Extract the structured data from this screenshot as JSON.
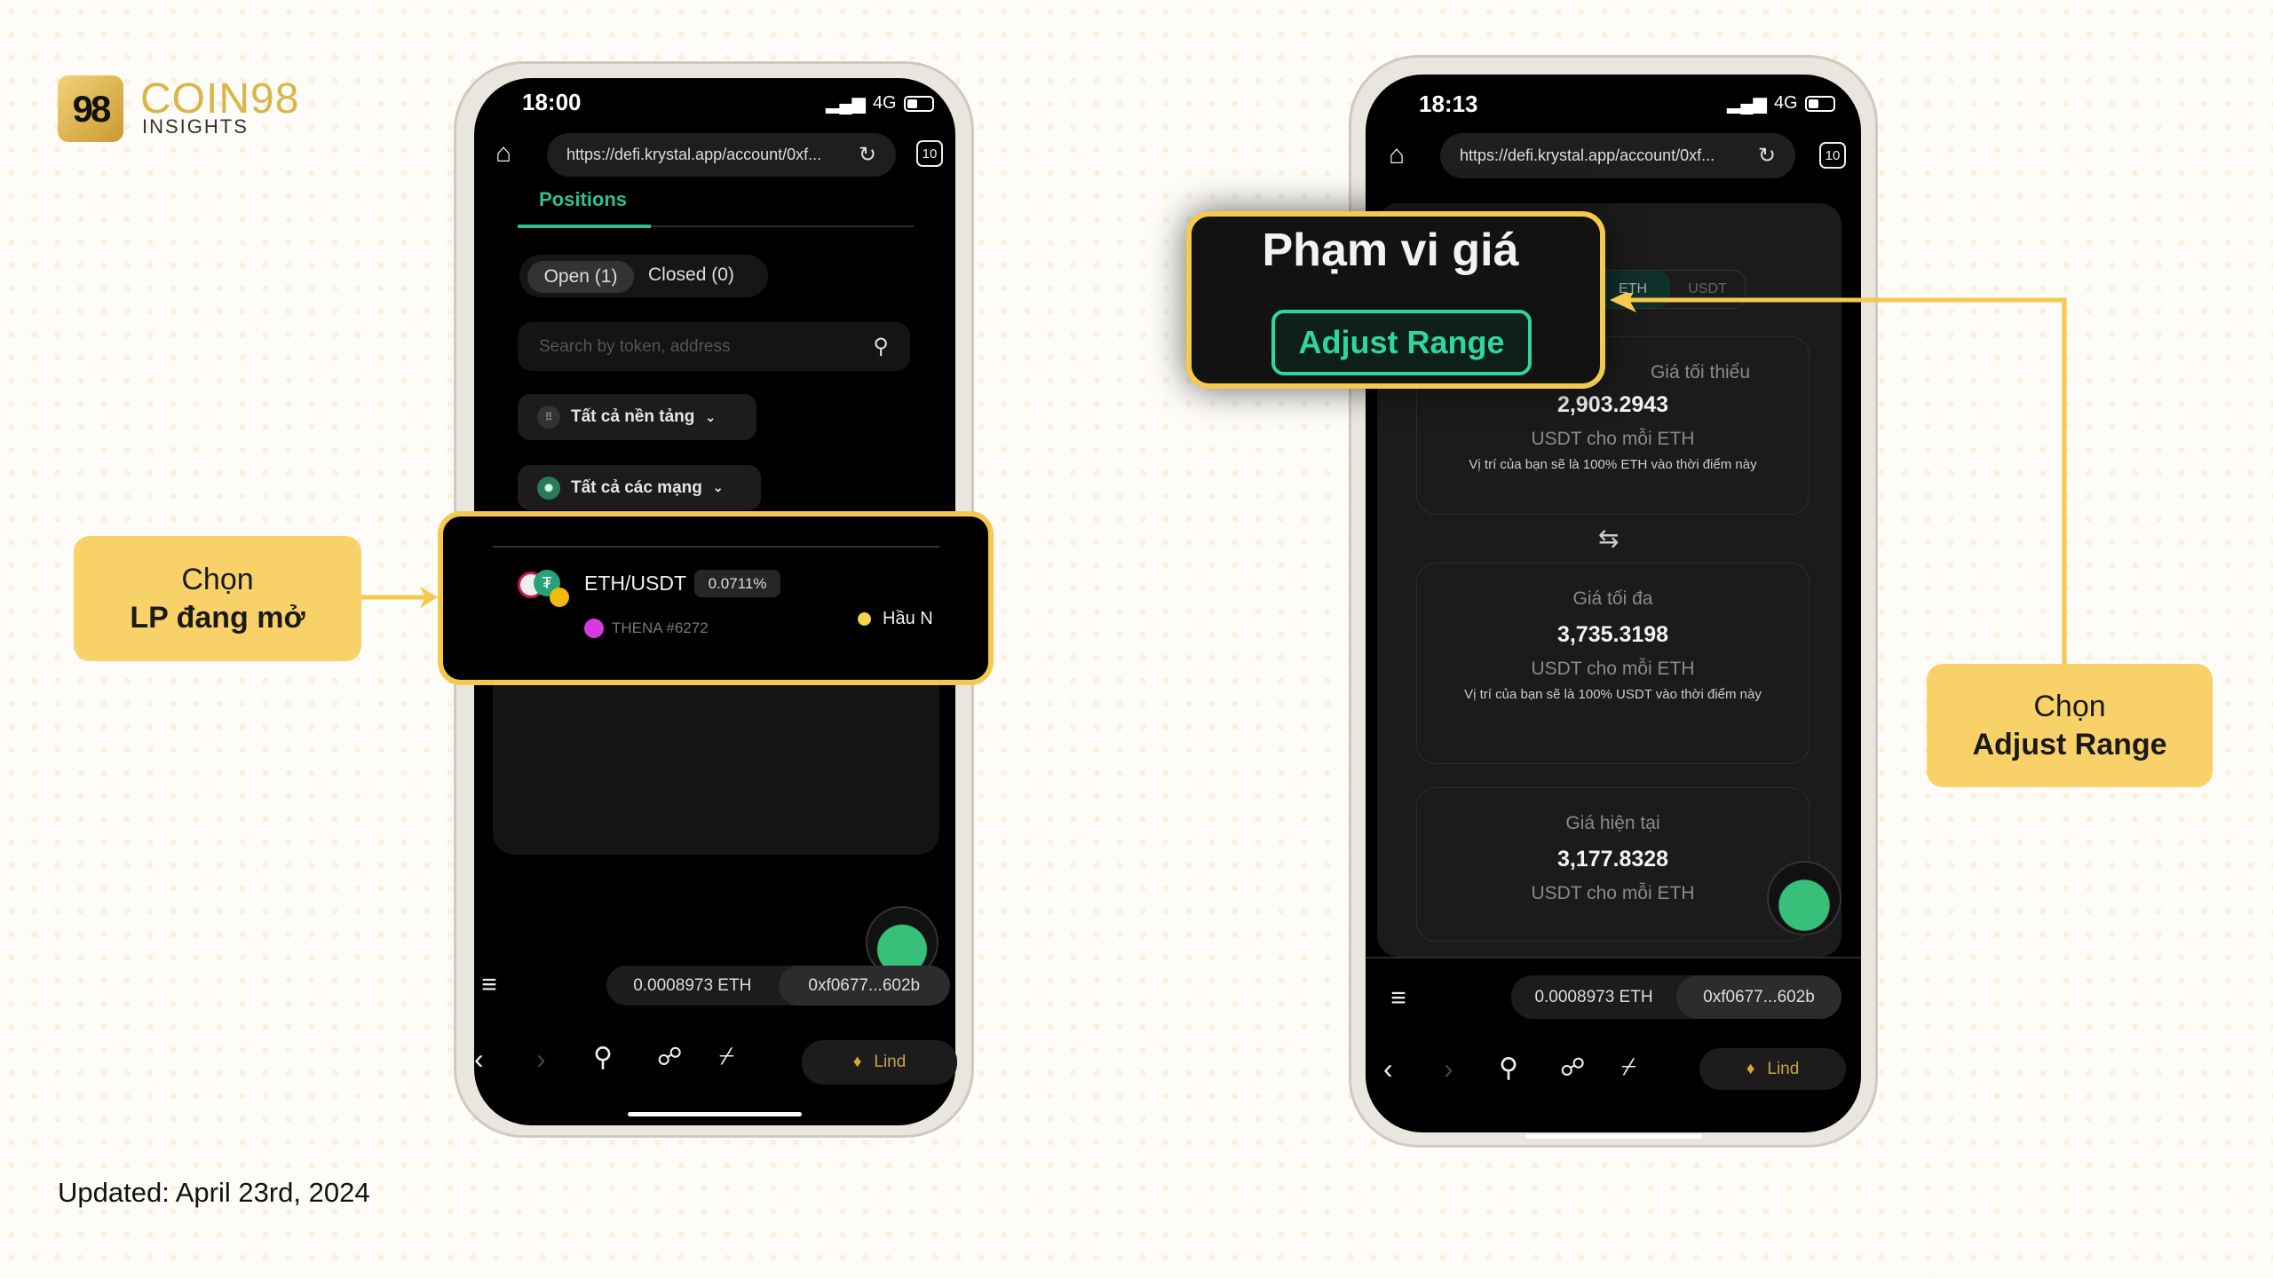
{
  "brand": {
    "logo_mark": "98",
    "name": "COIN98",
    "sub": "INSIGHTS"
  },
  "footer": {
    "updated": "Updated: April 23rd, 2024"
  },
  "colors": {
    "accent_yellow": "#f8d269",
    "green": "#2fd6a0",
    "phone_bg": "#000000"
  },
  "left_phone": {
    "time": "18:00",
    "network": "4G",
    "url": "https://defi.krystal.app/account/0xf...",
    "tab_count": "10",
    "tab_label": "Positions",
    "segments": [
      "Open (1)",
      "Closed (0)"
    ],
    "search_placeholder": "Search by token, address",
    "filters": [
      "Tất cả nền tảng",
      "Tất cả các mạng"
    ],
    "position": {
      "pair": "ETH/USDT",
      "fee": "0.0711%",
      "protocol": "THENA #6272",
      "status": "Hầu N"
    },
    "balance": "0.0008973 ETH",
    "address": "0xf0677...602b",
    "wallet": "Lind"
  },
  "right_phone": {
    "time": "18:13",
    "network": "4G",
    "url": "https://defi.krystal.app/account/0xf...",
    "tab_count": "10",
    "toggle": [
      "ETH",
      "USDT"
    ],
    "min": {
      "label": "Giá tối thiểu",
      "label_visible": "ối thiểu",
      "value": "2,903.2943",
      "unit": "USDT cho mỗi ETH",
      "note": "Vị trí của bạn sẽ là 100% ETH vào thời điểm này"
    },
    "max": {
      "label": "Giá tối đa",
      "value": "3,735.3198",
      "unit": "USDT cho mỗi ETH",
      "note": "Vị trí của bạn sẽ là 100% USDT vào thời điểm này"
    },
    "current": {
      "label": "Giá hiện tại",
      "value": "3,177.8328",
      "unit": "USDT cho mỗi ETH"
    },
    "balance": "0.0008973 ETH",
    "address": "0xf0677...602b",
    "wallet": "Lind"
  },
  "zoom_box": {
    "title": "Phạm vi giá",
    "button": "Adjust Range"
  },
  "callout_left": {
    "line1": "Chọn",
    "line2": "LP đang mở"
  },
  "callout_right": {
    "line1": "Chọn",
    "line2": "Adjust Range"
  }
}
